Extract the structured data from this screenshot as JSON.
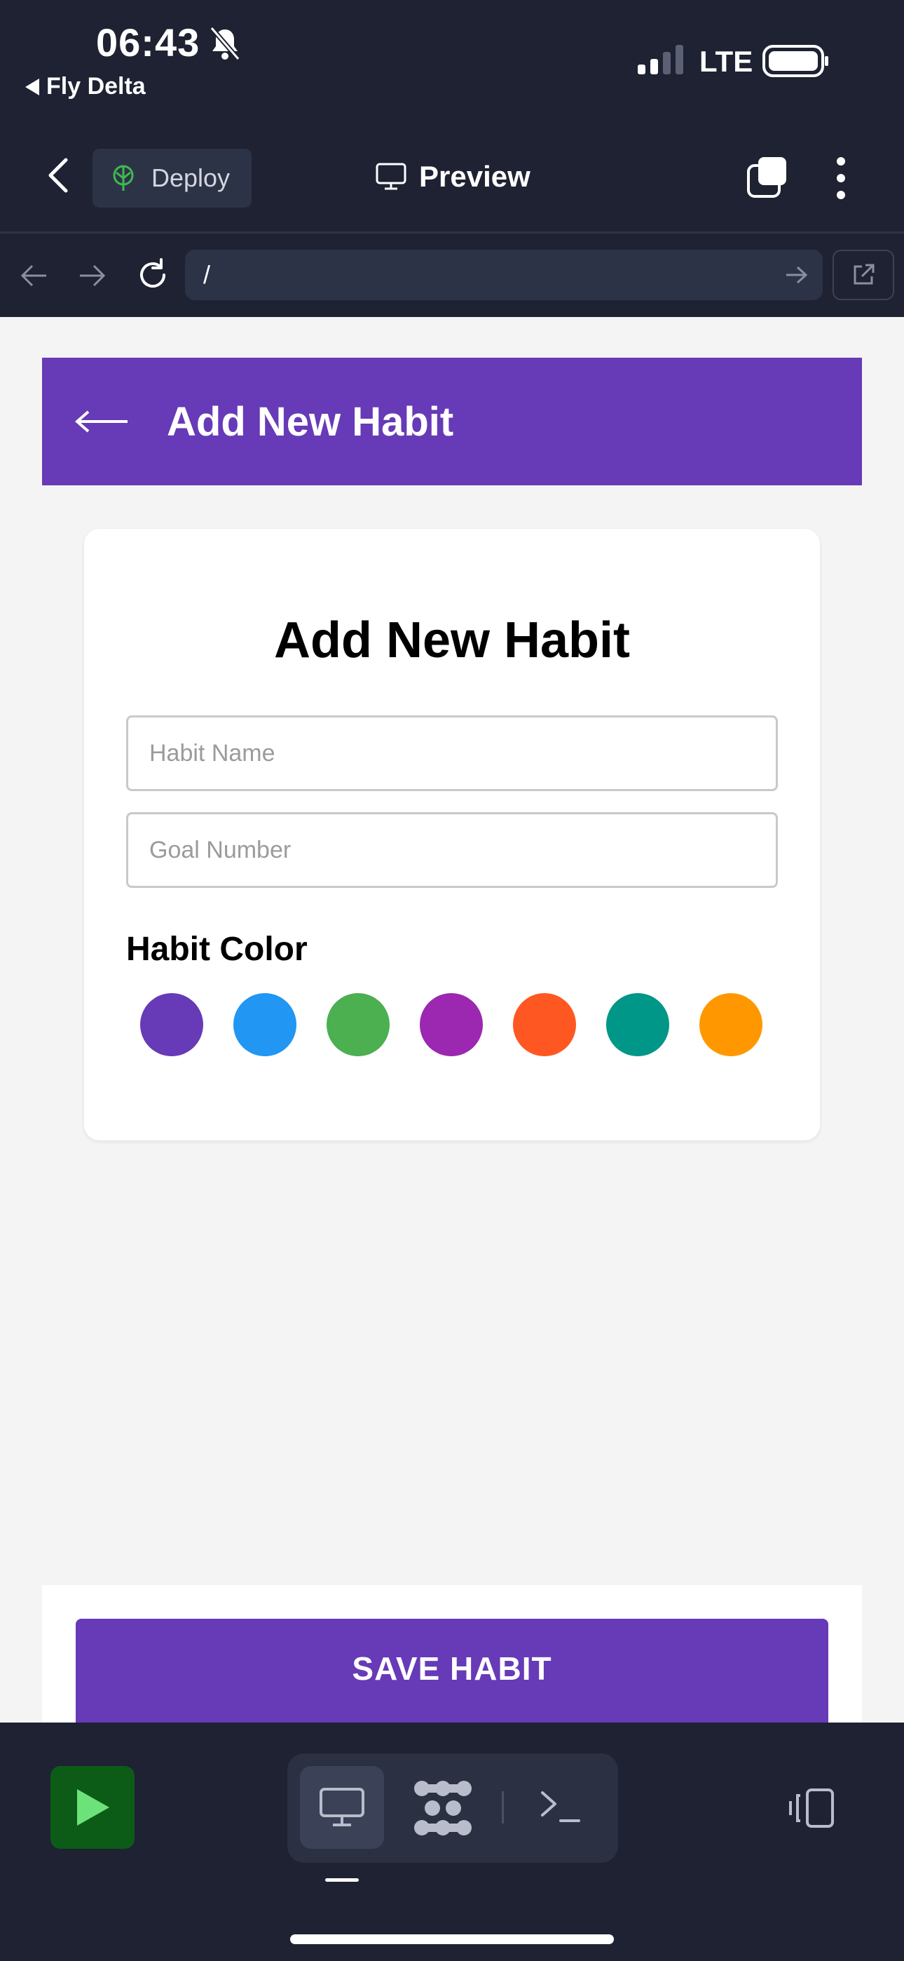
{
  "status_bar": {
    "time": "06:43",
    "back_app": "Fly Delta",
    "network": "LTE"
  },
  "ide_toolbar": {
    "deploy_label": "Deploy",
    "preview_label": "Preview"
  },
  "browser": {
    "url": "/"
  },
  "app": {
    "header_title": "Add New Habit",
    "card_title": "Add New Habit",
    "habit_name_placeholder": "Habit Name",
    "goal_number_placeholder": "Goal Number",
    "color_label": "Habit Color",
    "colors": [
      "#673ab7",
      "#2196f3",
      "#4caf50",
      "#9c27b0",
      "#ff5722",
      "#009688",
      "#ff9800"
    ],
    "save_label": "SAVE HABIT"
  },
  "theme": {
    "chrome_bg": "#1e2232",
    "accent": "#673ab7",
    "run_green": "#0c5c17"
  }
}
